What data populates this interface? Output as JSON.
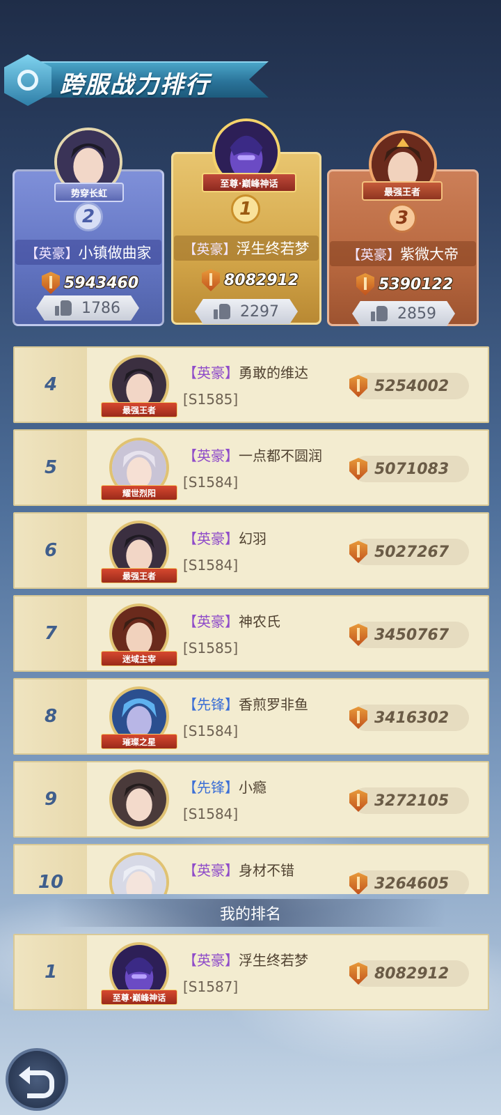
{
  "page": {
    "title": "跨服战力排行",
    "my_rank_label": "我的排名"
  },
  "colors": {
    "hero_tag": "#8f4cc9",
    "vanguard_tag": "#3c6fd6",
    "row_bg": "#f3ecd0",
    "gold_card": "#d4a74a",
    "silver_card": "#6274c2",
    "bronze_card": "#b8683f"
  },
  "podium": {
    "first": {
      "rank": "1",
      "title": "至尊·巅峰神话",
      "tag": "【英豪】",
      "name": "浮生终若梦",
      "power": "8082912",
      "likes": "2297"
    },
    "second": {
      "rank": "2",
      "title": "势穿长虹",
      "tag": "【英豪】",
      "name": "小镇做曲家",
      "power": "5943460",
      "likes": "1786"
    },
    "third": {
      "rank": "3",
      "title": "最强王者",
      "tag": "【英豪】",
      "name": "紫微大帝",
      "power": "5390122",
      "likes": "2859"
    }
  },
  "rankings": [
    {
      "rank": "4",
      "tag": "【英豪】",
      "name": "勇敢的维达",
      "server": "[S1585]",
      "power": "5254002",
      "title": "最强王者"
    },
    {
      "rank": "5",
      "tag": "【英豪】",
      "name": "一点都不圆润",
      "server": "[S1584]",
      "power": "5071083",
      "title": "耀世烈阳"
    },
    {
      "rank": "6",
      "tag": "【英豪】",
      "name": "幻羽",
      "server": "[S1584]",
      "power": "5027267",
      "title": "最强王者"
    },
    {
      "rank": "7",
      "tag": "【英豪】",
      "name": "神农氏",
      "server": "[S1585]",
      "power": "3450767",
      "title": "迷域主宰"
    },
    {
      "rank": "8",
      "tag": "【先锋】",
      "name": "香煎罗非鱼",
      "server": "[S1584]",
      "power": "3416302",
      "title": "璀璨之星"
    },
    {
      "rank": "9",
      "tag": "【先锋】",
      "name": "小瘾",
      "server": "[S1584]",
      "power": "3272105",
      "title": ""
    },
    {
      "rank": "10",
      "tag": "【英豪】",
      "name": "身材不错",
      "server": "",
      "power": "3264605",
      "title": ""
    }
  ],
  "my_ranking": {
    "rank": "1",
    "tag": "【英豪】",
    "name": "浮生终若梦",
    "server": "[S1587]",
    "power": "8082912",
    "title": "至尊·巅峰神话"
  },
  "icons": {
    "shield": "shield-icon",
    "like": "thumb-icon",
    "back": "back-arrow-icon"
  }
}
